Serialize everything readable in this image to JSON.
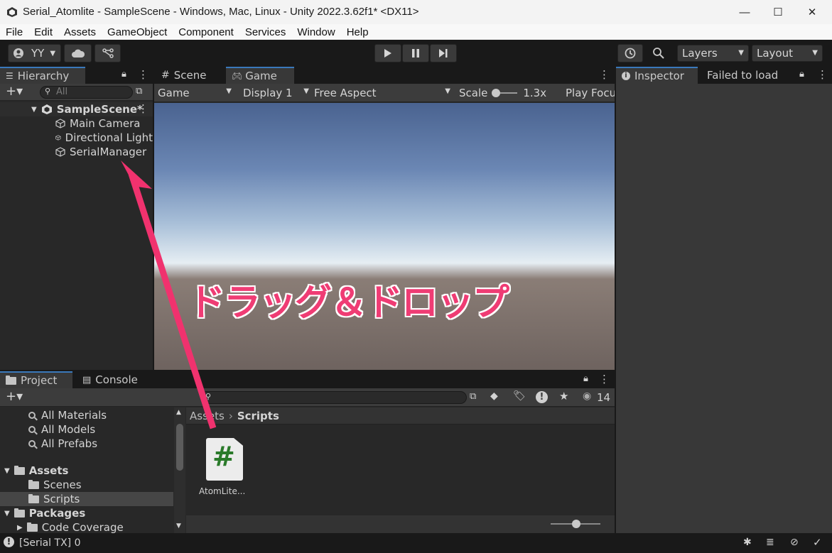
{
  "window": {
    "title": "Serial_Atomlite - SampleScene - Windows, Mac, Linux - Unity 2022.3.62f1* <DX11>",
    "minimize": "—",
    "maximize": "☐",
    "close": "✕"
  },
  "menu": [
    "File",
    "Edit",
    "Assets",
    "GameObject",
    "Component",
    "Services",
    "Window",
    "Help"
  ],
  "toolbar": {
    "account": "YY",
    "layers": "Layers",
    "layout": "Layout"
  },
  "hierarchy": {
    "tab": "Hierarchy",
    "search_placeholder": "All",
    "scene": "SampleScene*",
    "items": [
      "Main Camera",
      "Directional Light",
      "SerialManager"
    ]
  },
  "scene_tabs": {
    "scene": "Scene",
    "game": "Game"
  },
  "game_bar": {
    "mode": "Game",
    "display": "Display 1",
    "aspect": "Free Aspect",
    "scale_label": "Scale",
    "scale_value": "1.3x",
    "play_focus": "Play Focused"
  },
  "overlay": {
    "annotation": "ドラッグ＆ドロップ",
    "arrow_color": "#f0326e"
  },
  "inspector": {
    "tab": "Inspector",
    "tab2": "Failed to load"
  },
  "project": {
    "tab": "Project",
    "console_tab": "Console",
    "hidden_count": "14",
    "favorites": [
      "All Materials",
      "All Models",
      "All Prefabs"
    ],
    "assets_root": "Assets",
    "asset_folders": [
      "Scenes",
      "Scripts"
    ],
    "packages_root": "Packages",
    "package_items": [
      "Code Coverage"
    ],
    "breadcrumb": [
      "Assets",
      "Scripts"
    ],
    "files": [
      {
        "label": "AtomLite...",
        "icon": "#"
      }
    ]
  },
  "statusbar": {
    "text": "[Serial TX] 0"
  }
}
